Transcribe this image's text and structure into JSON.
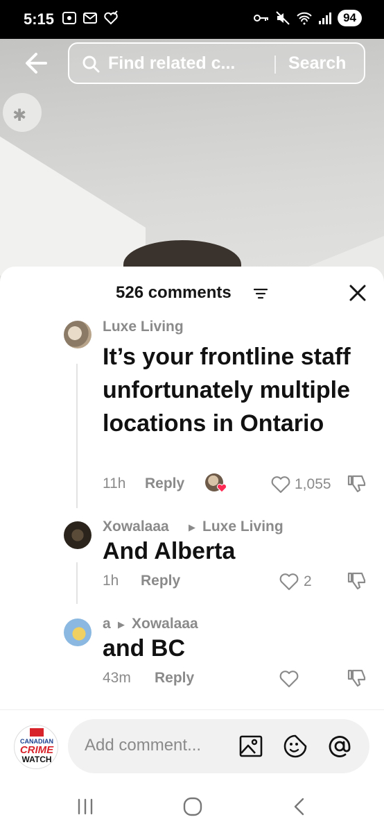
{
  "status_bar": {
    "time": "5:15",
    "battery": "94",
    "left_icons": [
      "screen-record-icon",
      "mail-icon",
      "heart-check-icon"
    ],
    "right_icons": [
      "key-icon",
      "mute-icon",
      "wifi-icon",
      "signal-icon"
    ]
  },
  "header": {
    "search_placeholder": "Find related c...",
    "search_button": "Search"
  },
  "comments_sheet": {
    "count_label": "526 comments",
    "comments": [
      {
        "username": "Luxe Living",
        "reply_to": "",
        "text": "It’s your frontline staff unfortunately multiple locations in Ontario",
        "time": "11h",
        "reply_label": "Reply",
        "likes": "1,055",
        "creator_liked": true
      },
      {
        "username": "Xowalaaa",
        "reply_to": "Luxe Living",
        "text": "And Alberta",
        "time": "1h",
        "reply_label": "Reply",
        "likes": "2"
      },
      {
        "username": "a",
        "reply_to": "Xowalaaa",
        "text": "and BC",
        "time": "43m",
        "reply_label": "Reply",
        "likes": ""
      }
    ]
  },
  "composer": {
    "channel_logo": {
      "line1": "CANADIAN",
      "line2": "CRIME",
      "line3": "WATCH"
    },
    "placeholder": "Add comment...",
    "icons": [
      "image-icon",
      "emoji-icon",
      "mention-icon"
    ]
  },
  "colors": {
    "accent_heart": "#fe2c55",
    "muted_text": "#8a8a8a"
  }
}
